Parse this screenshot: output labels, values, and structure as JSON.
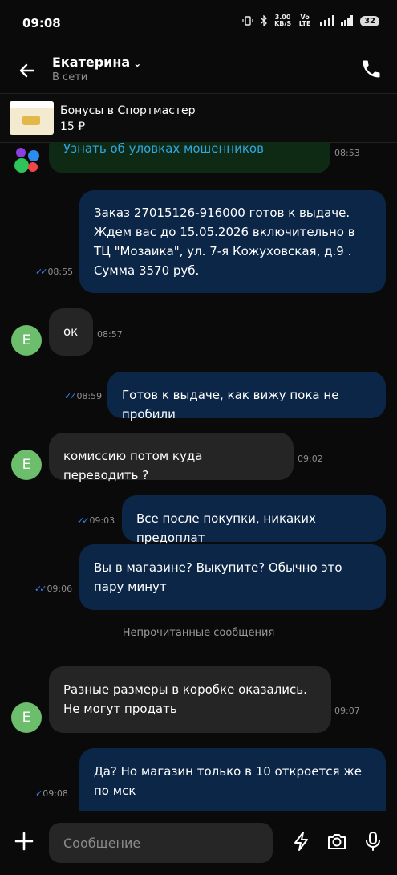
{
  "status_bar": {
    "time": "09:08",
    "speed_value": "3.00",
    "speed_unit": "KB/S",
    "network": "Vo LTE",
    "signal": "4G",
    "battery": "32"
  },
  "header": {
    "contact_name": "Екатерина",
    "contact_status": "В сети"
  },
  "promo": {
    "title": "Бонусы в Спортмастер",
    "value": "15 ₽"
  },
  "messages": [
    {
      "text": "Узнать об уловках мошенников",
      "time": "08:53"
    },
    {
      "text_prefix": "Заказ ",
      "order_link": "27015126-916000",
      "text_suffix": " готов к выдаче. Ждем вас до 15.05.2026 включительно в ТЦ \"Мозаика\", ул. 7-я Кожуховская, д.9 . Сумма 3570 руб.",
      "time": "08:55"
    },
    {
      "text": "ок",
      "time": "08:57",
      "avatar": "Е"
    },
    {
      "text": "Готов к выдаче, как вижу пока не пробили",
      "time": "08:59"
    },
    {
      "text": "комиссию потом куда переводить ?",
      "time": "09:02",
      "avatar": "Е"
    },
    {
      "text": "Все после покупки, никаких предоплат",
      "time": "09:03"
    },
    {
      "text": "Вы в магазине? Выкупите? Обычно это пару минут",
      "time": "09:06"
    },
    {
      "text": "Разные размеры в коробке оказались. Не могут продать",
      "time": "09:07",
      "avatar": "Е"
    },
    {
      "text": "Да? Но магазин только в 10 откроется же по мск",
      "time": "09:08"
    }
  ],
  "unread_divider": "Непрочитанные сообщения",
  "composer": {
    "placeholder": "Сообщение"
  },
  "colors": {
    "background": "#0a0a0a",
    "incoming": "#252525",
    "outgoing": "#0c2647",
    "avatar": "#6cbd6c",
    "read_ticks": "#3b82f6",
    "link": "#2ea7e0"
  }
}
